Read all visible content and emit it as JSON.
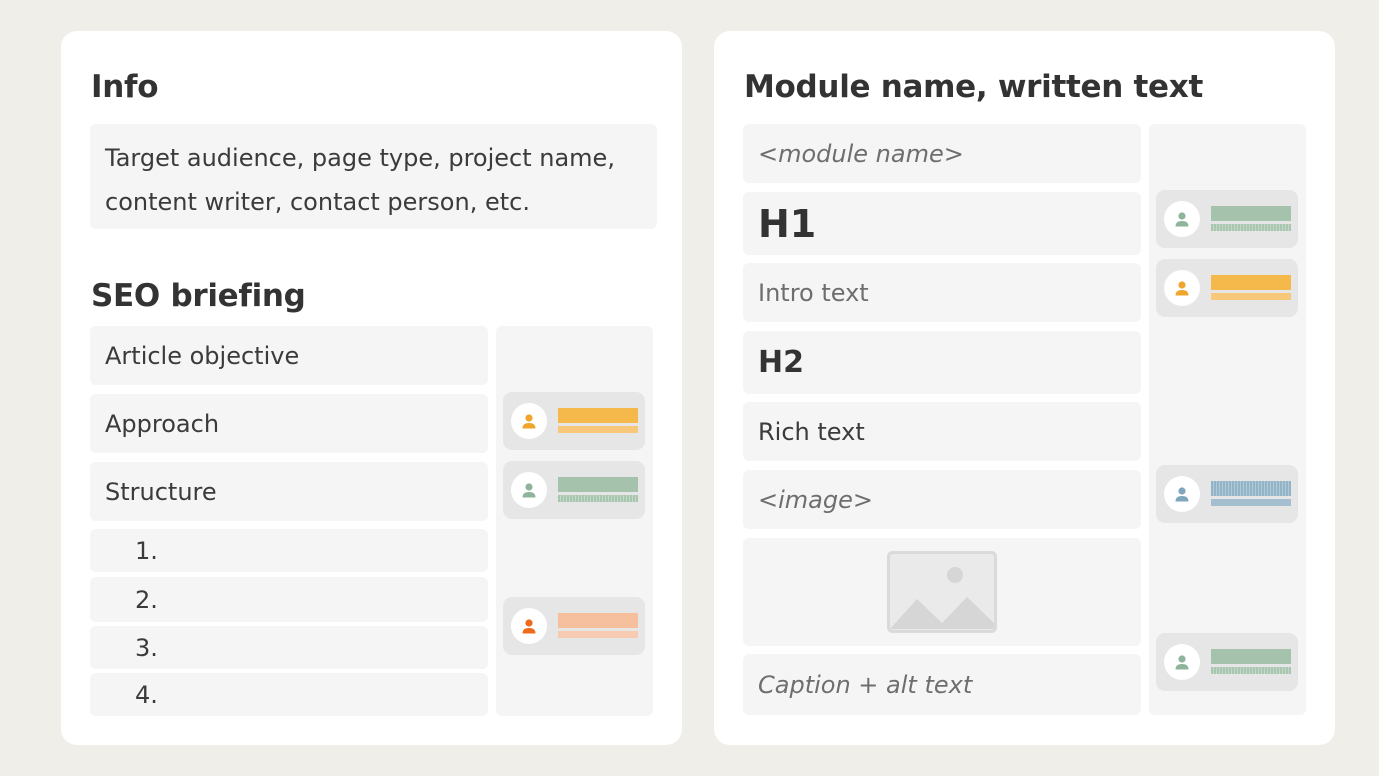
{
  "info": {
    "title": "Info",
    "description": "Target audience, page type, project name, content writer, contact person, etc."
  },
  "seo": {
    "title": "SEO briefing",
    "rows": [
      "Article objective",
      "Approach",
      "Structure"
    ],
    "numbered": [
      "1.",
      "2.",
      "3.",
      "4."
    ],
    "chips": [
      {
        "row": "Approach",
        "color": "orange",
        "icon": "person-icon"
      },
      {
        "row": "Structure",
        "color": "green",
        "icon": "person-icon"
      },
      {
        "row": "3.",
        "color": "salmon",
        "icon": "person-icon"
      }
    ]
  },
  "module": {
    "title": "Module name, written text",
    "module_name": "<module name>",
    "h1": "H1",
    "intro": "Intro text",
    "h2": "H2",
    "rich_text": "Rich text",
    "image": "<image>",
    "caption": "Caption + alt text",
    "image_icon": "image-placeholder-icon",
    "chips": [
      {
        "row": "H1",
        "color": "green",
        "icon": "person-icon"
      },
      {
        "row": "Intro text",
        "color": "orange",
        "icon": "person-icon"
      },
      {
        "row": "<image>",
        "color": "blue",
        "icon": "person-icon"
      },
      {
        "row": "Caption + alt text",
        "color": "green",
        "icon": "person-icon"
      }
    ]
  },
  "colors": {
    "background": "#efeee9",
    "card": "#ffffff",
    "row": "#f5f5f5",
    "chip": "#e6e6e6",
    "orange": "#f5b84b",
    "green": "#a4c2ac",
    "salmon": "#f6bf9e",
    "blue": "#93b4c7",
    "person_orange": "#f0a52c",
    "person_green": "#8fb49c",
    "person_salmon": "#ee6a1c",
    "person_blue": "#7fa6bd"
  }
}
